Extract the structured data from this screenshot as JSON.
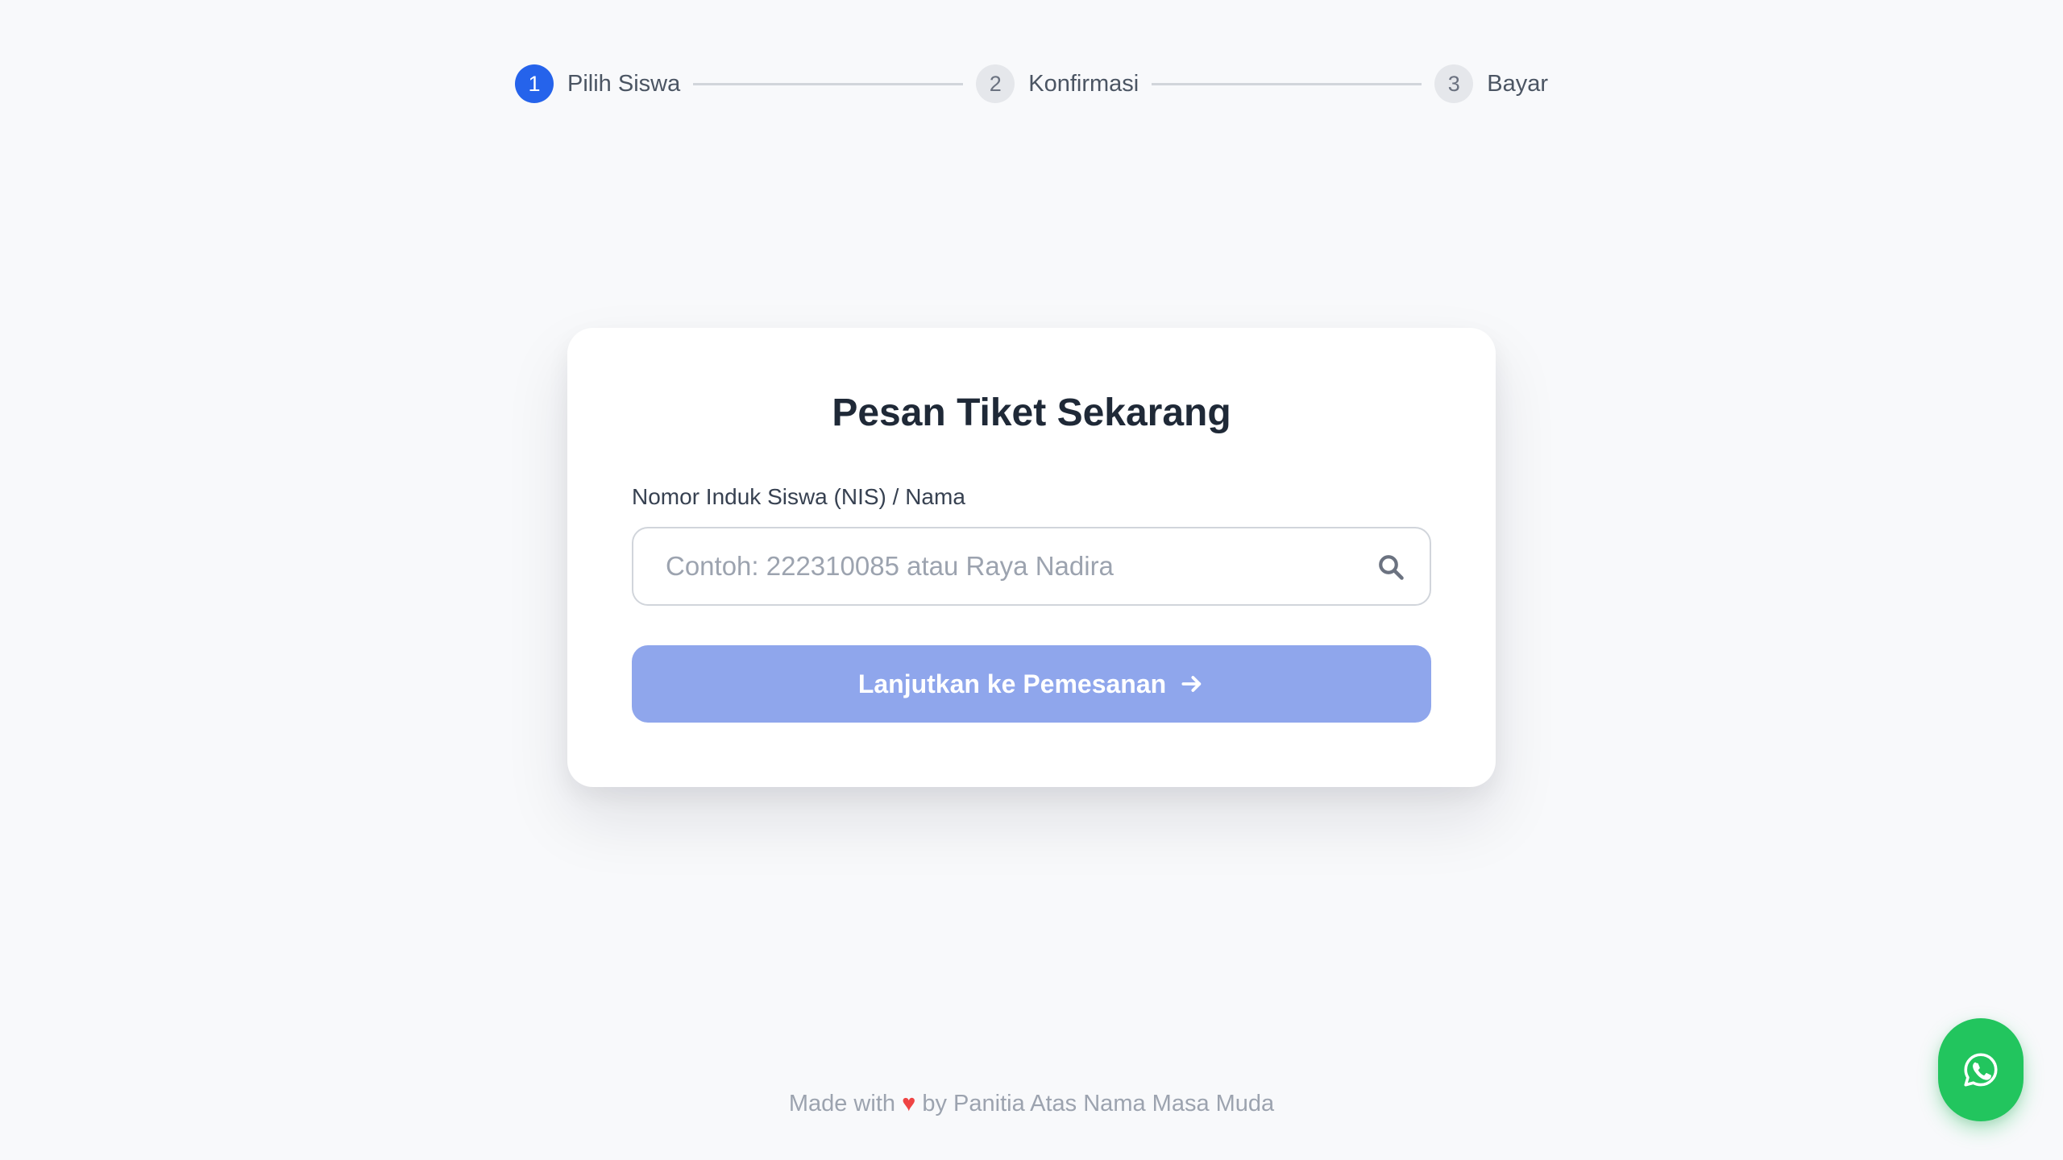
{
  "stepper": {
    "steps": [
      {
        "number": "1",
        "label": "Pilih Siswa",
        "active": true
      },
      {
        "number": "2",
        "label": "Konfirmasi",
        "active": false
      },
      {
        "number": "3",
        "label": "Bayar",
        "active": false
      }
    ]
  },
  "card": {
    "title": "Pesan Tiket Sekarang",
    "field_label": "Nomor Induk Siswa (NIS) / Nama",
    "search": {
      "value": "",
      "placeholder": "Contoh: 222310085 atau Raya Nadira",
      "icon": "search-icon"
    },
    "submit_label": "Lanjutkan ke Pemesanan",
    "submit_icon": "arrow-right-icon"
  },
  "footer": {
    "prefix": "Made with",
    "heart": "♥",
    "suffix": "by Panitia Atas Nama Masa Muda"
  },
  "fab": {
    "icon": "whatsapp-icon"
  },
  "colors": {
    "background": "#f8f9fb",
    "accent": "#2563eb",
    "button_disabled": "#8fa6ec",
    "whatsapp": "#22c55e",
    "heart": "#ef4444"
  }
}
